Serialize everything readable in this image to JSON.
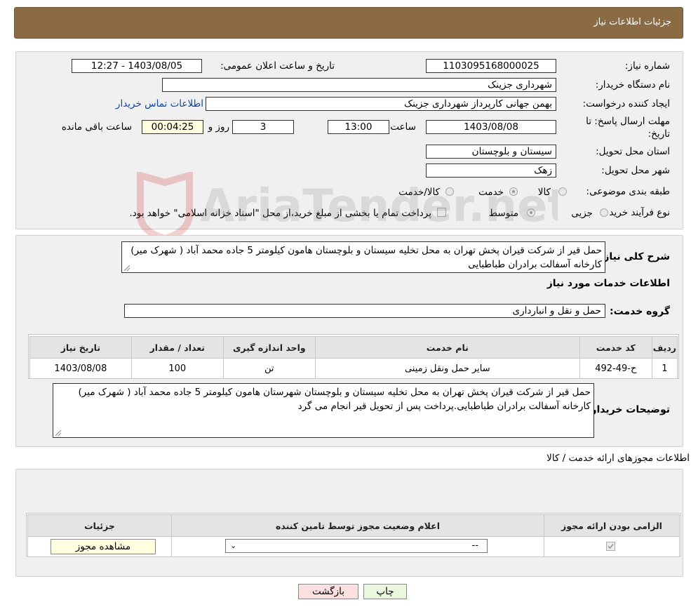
{
  "header": {
    "title": "جزئیات اطلاعات نیاز"
  },
  "info": {
    "need_number_label": "شماره نیاز:",
    "need_number": "1103095168000025",
    "announce_label": "تاریخ و ساعت اعلان عمومی:",
    "announce_value": "1403/08/05 - 12:27",
    "buyer_org_label": "نام دستگاه خریدار:",
    "buyer_org": "شهرداری جزینک",
    "creator_label": "ایجاد کننده درخواست:",
    "creator": "بهمن جهانی کارپرداز شهرداری جزینک",
    "contact_link": "اطلاعات تماس خریدار",
    "deadline_label_1": "مهلت ارسال پاسخ: تا",
    "deadline_label_2": "تاریخ:",
    "deadline_date": "1403/08/08",
    "time_label": "ساعت",
    "deadline_time": "13:00",
    "days_value": "3",
    "days_label": "روز و",
    "remaining_time": "00:04:25",
    "remaining_label": "ساعت باقی مانده",
    "province_label": "استان محل تحویل:",
    "province": "سیستان و بلوچستان",
    "city_label": "شهر محل تحویل:",
    "city": "زهک",
    "category_label": "طبقه بندی موضوعی:",
    "category_options": [
      {
        "label": "کالا",
        "checked": false
      },
      {
        "label": "خدمت",
        "checked": true
      },
      {
        "label": "کالا/خدمت",
        "checked": false
      }
    ],
    "process_label": "نوع فرآیند خرید :",
    "process_options": [
      {
        "label": "جزیی",
        "checked": false
      },
      {
        "label": "متوسط",
        "checked": true
      }
    ],
    "payment_note": "پرداخت تمام یا بخشی از مبلغ خرید،از محل \"اسناد خزانه اسلامی\" خواهد بود."
  },
  "description": {
    "label": "شرح کلی نیاز:",
    "text": "حمل قیر از شرکت قیران پخش تهران به محل تخلیه سیستان و بلوچستان هامون کیلومتر 5 جاده محمد آباد ( شهرک میر) کارخانه آسفالت برادران طباطبایی"
  },
  "services": {
    "section_title": "اطلاعات خدمات مورد نیاز",
    "group_label": "گروه خدمت:",
    "group_value": "حمل و نقل و انبارداری",
    "columns": [
      "ردیف",
      "کد خدمت",
      "نام خدمت",
      "واحد اندازه گیری",
      "تعداد / مقدار",
      "تاریخ نیاز"
    ],
    "rows": [
      [
        "1",
        "ح-49-492",
        "سایر حمل ونقل زمینی",
        "تن",
        "100",
        "1403/08/08"
      ]
    ]
  },
  "buyer_notes": {
    "label": "توضیحات خریدار:",
    "text": "حمل قیر از شرکت قیران پخش تهران به محل تخلیه  سیستان و بلوچستان شهرستان هامون کیلومتر 5 جاده محمد آباد ( شهرک میر) کارخانه آسفالت برادران طباطبایی.پرداخت پس از تحویل قیر انجام می گرد"
  },
  "permits": {
    "section_title": "اطلاعات مجوزهای ارائه خدمت / کالا",
    "columns": [
      "الزامی بودن ارائه مجوز",
      "اعلام وضعیت مجوز توسط تامین کننده",
      "جزئیات"
    ],
    "row": {
      "required_checked": true,
      "status_value": "--",
      "view_button": "مشاهده مجوز"
    }
  },
  "footer": {
    "print_button": "چاپ",
    "back_button": "بازگشت"
  },
  "watermark": {
    "text": "AriaTender.net"
  }
}
